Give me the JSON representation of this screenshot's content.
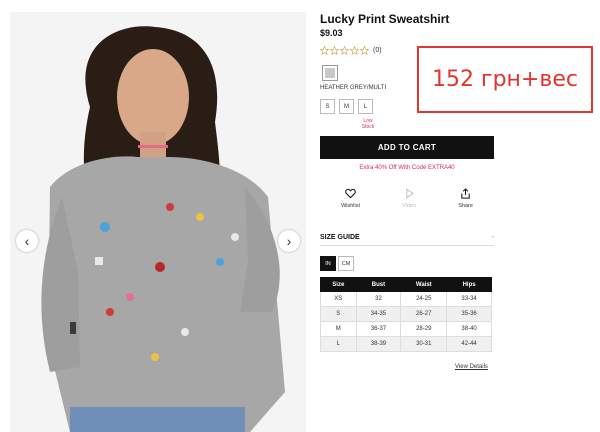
{
  "product": {
    "title": "Lucky Print Sweatshirt",
    "price": "$9.03",
    "review_count": "(0)",
    "color_name": "HEATHER GREY/MULTI",
    "sizes": [
      "S",
      "M",
      "L"
    ],
    "low_stock_label": "Low Stock",
    "add_to_cart": "ADD TO CART",
    "promo": "Extra 40% Off With Code EXTRA40"
  },
  "actions": {
    "wishlist": "Wishlist",
    "video": "Video",
    "share": "Share"
  },
  "size_guide": {
    "heading": "SIZE GUIDE",
    "toggle": "-",
    "units": [
      "IN",
      "CM"
    ],
    "active_unit": "IN",
    "columns": [
      "Size",
      "Bust",
      "Waist",
      "Hips"
    ],
    "rows": [
      [
        "XS",
        "32",
        "24-25",
        "33-34"
      ],
      [
        "S",
        "34-35",
        "26-27",
        "35-36"
      ],
      [
        "M",
        "36-37",
        "28-29",
        "38-40"
      ],
      [
        "L",
        "38-39",
        "30-31",
        "42-44"
      ]
    ],
    "view_details": "View Details"
  },
  "gallery": {
    "prev_icon": "chevron-left-icon",
    "next_icon": "chevron-right-icon"
  },
  "annotation": {
    "text": "152 грн+вес",
    "color": "#e3342f"
  },
  "colors": {
    "accent_pink": "#e0245e",
    "cart_bg": "#111111"
  }
}
